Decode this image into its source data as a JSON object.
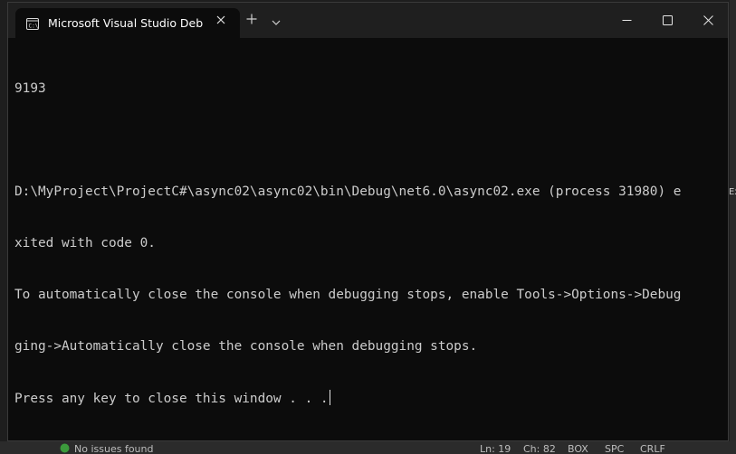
{
  "window": {
    "tab_title": "Microsoft Visual Studio Debug",
    "tab_icon": "console-app-icon",
    "close_tab_icon": "close-icon",
    "new_tab_icon": "plus-icon",
    "dropdown_icon": "chevron-down-icon",
    "controls": {
      "minimize_icon": "minimize-icon",
      "maximize_icon": "maximize-icon",
      "close_icon": "close-icon"
    }
  },
  "console": {
    "lines": [
      "9193",
      "",
      "D:\\MyProject\\ProjectC#\\async02\\async02\\bin\\Debug\\net6.0\\async02.exe (process 31980) e",
      "xited with code 0.",
      "To automatically close the console when debugging stops, enable Tools->Options->Debug",
      "ging->Automatically close the console when debugging stops.",
      "Press any key to close this window . . ."
    ]
  },
  "background_ide": {
    "status_bar": {
      "issues": "No issues found",
      "line": "Ln: 19",
      "char": "Ch: 82",
      "mode": "BOX",
      "whitespace": "SPC",
      "line_ending": "CRLF"
    },
    "side_label": "Ex"
  },
  "colors": {
    "terminal_bg": "#0c0c0c",
    "titlebar_bg": "#1f1f1f",
    "text": "#cccccc"
  }
}
